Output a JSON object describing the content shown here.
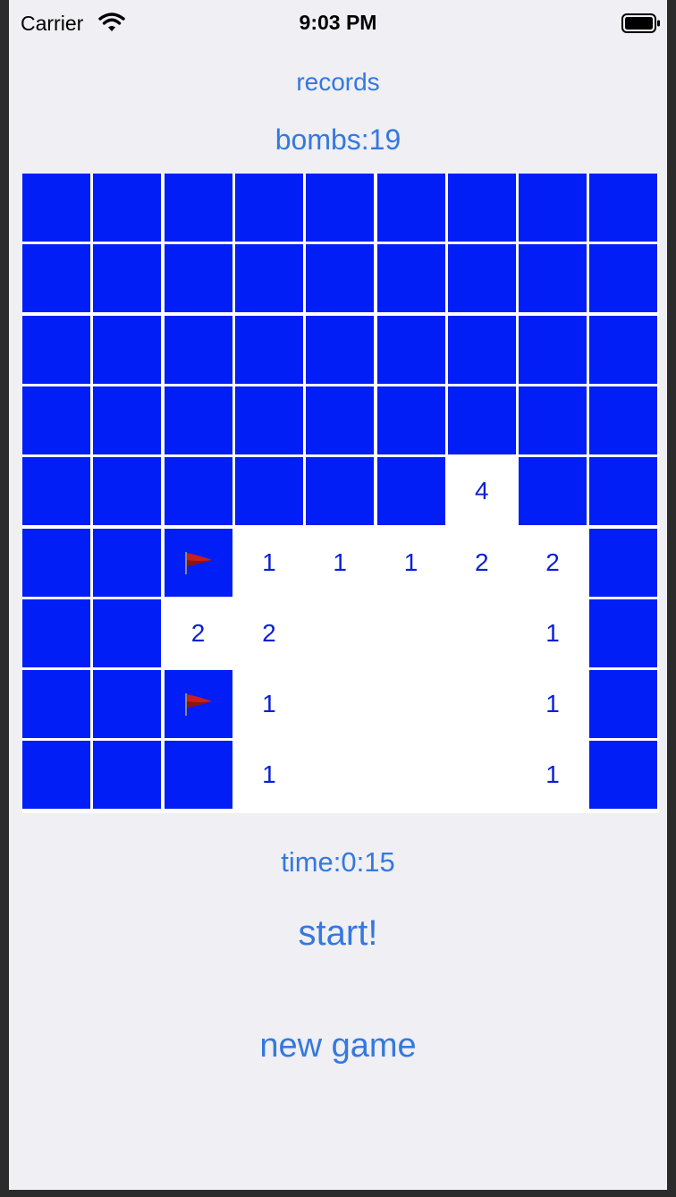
{
  "status_bar": {
    "carrier": "Carrier",
    "time": "9:03 PM",
    "wifi_icon": "wifi-icon",
    "battery_icon": "battery-icon"
  },
  "records_label": "records",
  "bombs_label": "bombs:19",
  "time_label": "time:0:15",
  "start_label": "start!",
  "new_game_label": "new game",
  "colors": {
    "accent": "#3478e0",
    "covered": "#001ef5",
    "number": "#0a1fd6",
    "background": "#efeff4",
    "flag": "#c8201e"
  },
  "board": {
    "rows": 9,
    "cols": 9,
    "cells": [
      [
        "C",
        "C",
        "C",
        "C",
        "C",
        "C",
        "C",
        "C",
        "C"
      ],
      [
        "C",
        "C",
        "C",
        "C",
        "C",
        "C",
        "C",
        "C",
        "C"
      ],
      [
        "C",
        "C",
        "C",
        "C",
        "C",
        "C",
        "C",
        "C",
        "C"
      ],
      [
        "C",
        "C",
        "C",
        "C",
        "C",
        "C",
        "C",
        "C",
        "C"
      ],
      [
        "C",
        "C",
        "C",
        "C",
        "C",
        "C",
        "4",
        "C",
        "C"
      ],
      [
        "C",
        "C",
        "F",
        "1",
        "1",
        "1",
        "2",
        "2",
        "C"
      ],
      [
        "C",
        "C",
        "2",
        "2",
        "",
        "",
        "",
        "1",
        "C"
      ],
      [
        "C",
        "C",
        "F",
        "1",
        "",
        "",
        "",
        "1",
        "C"
      ],
      [
        "C",
        "C",
        "C",
        "1",
        "",
        "",
        "",
        "1",
        "C"
      ]
    ]
  }
}
